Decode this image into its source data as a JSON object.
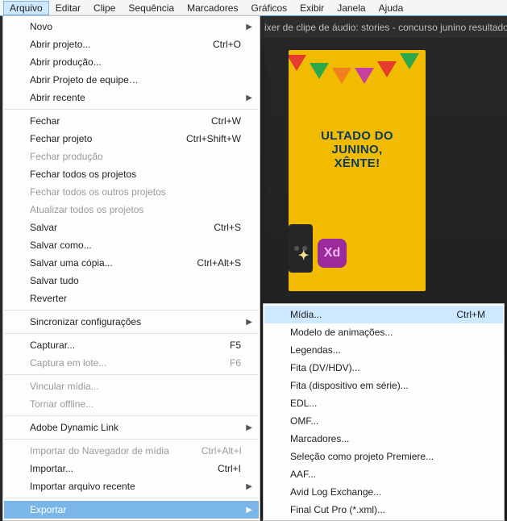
{
  "menubar": {
    "items": [
      "Arquivo",
      "Editar",
      "Clipe",
      "Sequência",
      "Marcadores",
      "Gráficos",
      "Exibir",
      "Janela",
      "Ajuda"
    ]
  },
  "titlebar": {
    "text": "ixer de clipe de áudio: stories - concurso junino resultado"
  },
  "poster": {
    "line1": "ULTADO DO",
    "line2": "JUNINO,",
    "line3": "XÊNTE!",
    "plus": "✦",
    "xd": "Xd"
  },
  "fileMenu": [
    {
      "label": "Novo",
      "submenu": true
    },
    {
      "label": "Abrir projeto...",
      "shortcut": "Ctrl+O"
    },
    {
      "label": "Abrir produção..."
    },
    {
      "label": "Abrir Projeto de equipe…"
    },
    {
      "label": "Abrir recente",
      "submenu": true
    },
    {
      "sep": true
    },
    {
      "label": "Fechar",
      "shortcut": "Ctrl+W"
    },
    {
      "label": "Fechar projeto",
      "shortcut": "Ctrl+Shift+W"
    },
    {
      "label": "Fechar produção",
      "disabled": true
    },
    {
      "label": "Fechar todos os projetos"
    },
    {
      "label": "Fechar todos os outros projetos",
      "disabled": true
    },
    {
      "label": "Atualizar todos os projetos",
      "disabled": true
    },
    {
      "label": "Salvar",
      "shortcut": "Ctrl+S"
    },
    {
      "label": "Salvar como..."
    },
    {
      "label": "Salvar uma cópia...",
      "shortcut": "Ctrl+Alt+S"
    },
    {
      "label": "Salvar tudo"
    },
    {
      "label": "Reverter"
    },
    {
      "sep": true
    },
    {
      "label": "Sincronizar configurações",
      "submenu": true
    },
    {
      "sep": true
    },
    {
      "label": "Capturar...",
      "shortcut": "F5"
    },
    {
      "label": "Captura em lote...",
      "shortcut": "F6",
      "disabled": true
    },
    {
      "sep": true
    },
    {
      "label": "Vincular mídia...",
      "disabled": true
    },
    {
      "label": "Tornar offline...",
      "disabled": true
    },
    {
      "sep": true
    },
    {
      "label": "Adobe Dynamic Link",
      "submenu": true
    },
    {
      "sep": true
    },
    {
      "label": "Importar do Navegador de mídia",
      "shortcut": "Ctrl+Alt+I",
      "disabled": true
    },
    {
      "label": "Importar...",
      "shortcut": "Ctrl+I"
    },
    {
      "label": "Importar arquivo recente",
      "submenu": true
    },
    {
      "sep": true
    },
    {
      "label": "Exportar",
      "submenu": true,
      "selected": true
    }
  ],
  "exportMenu": [
    {
      "label": "Mídia...",
      "shortcut": "Ctrl+M",
      "hover": true
    },
    {
      "label": "Modelo de animações..."
    },
    {
      "label": "Legendas..."
    },
    {
      "label": "Fita (DV/HDV)..."
    },
    {
      "label": "Fita (dispositivo em série)..."
    },
    {
      "label": "EDL..."
    },
    {
      "label": "OMF..."
    },
    {
      "label": "Marcadores..."
    },
    {
      "label": "Seleção como projeto Premiere..."
    },
    {
      "label": "AAF..."
    },
    {
      "label": "Avid Log Exchange..."
    },
    {
      "label": "Final Cut Pro  (*.xml)..."
    }
  ]
}
